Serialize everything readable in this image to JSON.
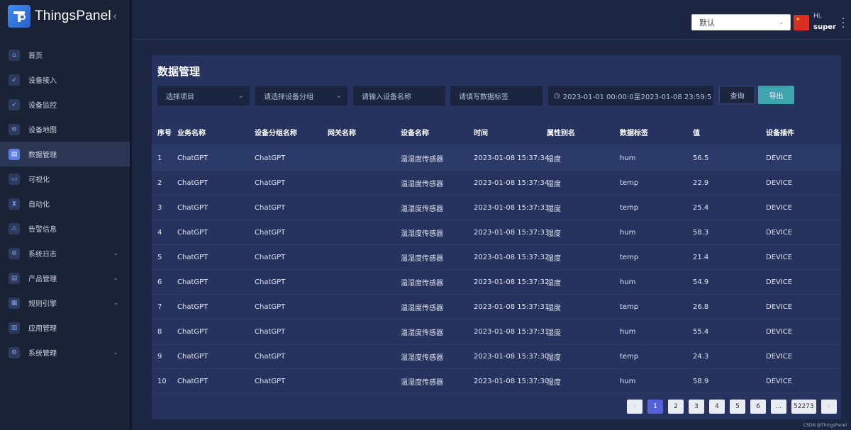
{
  "app": {
    "name": "ThingsPanel"
  },
  "sidebar": {
    "items": [
      {
        "label": "首页",
        "icon": "home-icon"
      },
      {
        "label": "设备接入",
        "icon": "rocket-icon"
      },
      {
        "label": "设备监控",
        "icon": "rocket-icon"
      },
      {
        "label": "设备地图",
        "icon": "gear-icon"
      },
      {
        "label": "数据管理",
        "icon": "clipboard-icon",
        "active": true
      },
      {
        "label": "可视化",
        "icon": "chart-icon"
      },
      {
        "label": "自动化",
        "icon": "hourglass-icon"
      },
      {
        "label": "告警信息",
        "icon": "warning-icon"
      },
      {
        "label": "系统日志",
        "icon": "gear-icon",
        "expandable": true
      },
      {
        "label": "产品管理",
        "icon": "clipboard-icon",
        "expandable": true
      },
      {
        "label": "规则引擎",
        "icon": "gift-icon",
        "expandable": true
      },
      {
        "label": "应用管理",
        "icon": "store-icon"
      },
      {
        "label": "系统管理",
        "icon": "gear-icon",
        "expandable": true
      }
    ]
  },
  "topbar": {
    "selected": "默认",
    "greeting": "Hi,",
    "username": "super"
  },
  "page": {
    "title": "数据管理",
    "filters": {
      "project": "选择项目",
      "group": "请选择设备分组",
      "device_name": "请输入设备名称",
      "data_tag": "请填写数据标签",
      "date_range": "2023-01-01 00:00:0至2023-01-08 23:59:5"
    },
    "query_label": "查询",
    "export_label": "导出"
  },
  "table": {
    "headers": [
      "序号",
      "业务名称",
      "设备分组名称",
      "网关名称",
      "设备名称",
      "时间",
      "属性别名",
      "数据标签",
      "值",
      "设备插件"
    ],
    "rows": [
      [
        "1",
        "ChatGPT",
        "ChatGPT",
        "",
        "温湿度传感器",
        "2023-01-08 15:37:34",
        "湿度",
        "hum",
        "56.5",
        "DEVICE"
      ],
      [
        "2",
        "ChatGPT",
        "ChatGPT",
        "",
        "温湿度传感器",
        "2023-01-08 15:37:34",
        "湿度",
        "temp",
        "22.9",
        "DEVICE"
      ],
      [
        "3",
        "ChatGPT",
        "ChatGPT",
        "",
        "温湿度传感器",
        "2023-01-08 15:37:33",
        "湿度",
        "temp",
        "25.4",
        "DEVICE"
      ],
      [
        "4",
        "ChatGPT",
        "ChatGPT",
        "",
        "温湿度传感器",
        "2023-01-08 15:37:33",
        "湿度",
        "hum",
        "58.3",
        "DEVICE"
      ],
      [
        "5",
        "ChatGPT",
        "ChatGPT",
        "",
        "温湿度传感器",
        "2023-01-08 15:37:32",
        "湿度",
        "temp",
        "21.4",
        "DEVICE"
      ],
      [
        "6",
        "ChatGPT",
        "ChatGPT",
        "",
        "温湿度传感器",
        "2023-01-08 15:37:32",
        "湿度",
        "hum",
        "54.9",
        "DEVICE"
      ],
      [
        "7",
        "ChatGPT",
        "ChatGPT",
        "",
        "温湿度传感器",
        "2023-01-08 15:37:31",
        "湿度",
        "temp",
        "26.8",
        "DEVICE"
      ],
      [
        "8",
        "ChatGPT",
        "ChatGPT",
        "",
        "温湿度传感器",
        "2023-01-08 15:37:31",
        "湿度",
        "hum",
        "55.4",
        "DEVICE"
      ],
      [
        "9",
        "ChatGPT",
        "ChatGPT",
        "",
        "温湿度传感器",
        "2023-01-08 15:37:30",
        "湿度",
        "temp",
        "24.3",
        "DEVICE"
      ],
      [
        "10",
        "ChatGPT",
        "ChatGPT",
        "",
        "温湿度传感器",
        "2023-01-08 15:37:30",
        "湿度",
        "hum",
        "58.9",
        "DEVICE"
      ]
    ]
  },
  "pagination": {
    "prev": "‹",
    "pages": [
      "1",
      "2",
      "3",
      "4",
      "5",
      "6"
    ],
    "ellipsis": "...",
    "last": "52273",
    "next": "›",
    "current": "1"
  },
  "watermark": "CSDN @ThingsPanel",
  "colors": {
    "accent": "#5561d6",
    "export": "#3fa4ad",
    "flag": "#d93025"
  }
}
